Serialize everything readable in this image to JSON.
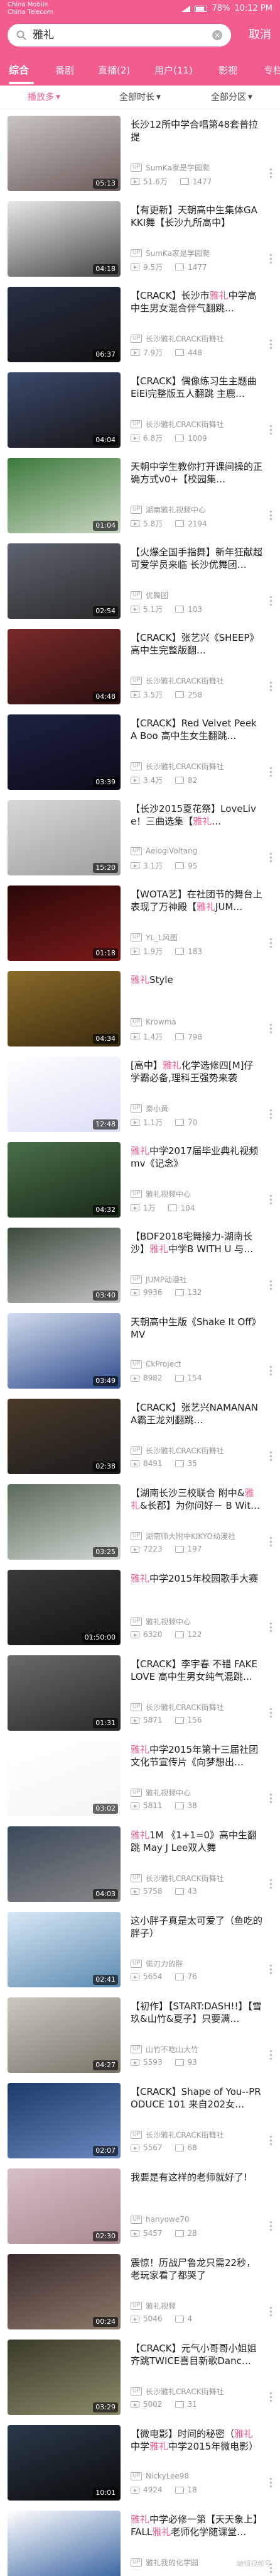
{
  "status_bar": {
    "carrier_1": "China Mobile",
    "carrier_2": "China Telecom",
    "battery": "78%",
    "time": "10:12 PM"
  },
  "search": {
    "value": "雅礼",
    "cancel_label": "取消"
  },
  "tabs": [
    "综合",
    "番剧",
    "直播(2)",
    "用户(11)",
    "影视",
    "专栏"
  ],
  "filters": {
    "sort": "播放多",
    "duration": "全部时长",
    "zone": "全部分区"
  },
  "highlight_keyword": "雅礼",
  "results": [
    {
      "title": "长沙12所中学合唱第48套普拉提",
      "uploader": "SumKa家是学园爬",
      "plays": "51.6万",
      "danmaku": "1477",
      "duration": "05:13",
      "thumb_colors": [
        "#c9c4c2",
        "#6b5b58"
      ]
    },
    {
      "title": "【有更新】天朝高中生集体GAKKI舞【长沙九所高中】",
      "uploader": "SumKa家是学园爬",
      "plays": "9.5万",
      "danmaku": "1477",
      "duration": "04:18",
      "thumb_colors": [
        "#e8e8e8",
        "#444444"
      ]
    },
    {
      "title": "【CRACK】长沙市雅礼中学高中生男女混合伴气翻跳…",
      "uploader": "长沙雅礼CRACK街舞社",
      "plays": "7.9万",
      "danmaku": "448",
      "duration": "06:37",
      "thumb_colors": [
        "#263043",
        "#111111"
      ]
    },
    {
      "title": "【CRACK】偶像练习生主题曲EiEi完整版五人翻跳 主鹿…",
      "uploader": "长沙雅礼CRACK街舞社",
      "plays": "6.8万",
      "danmaku": "1009",
      "duration": "04:04",
      "thumb_colors": [
        "#3b4a6b",
        "#151515"
      ]
    },
    {
      "title": "天朝中学生教你打开课间操的正确方式v0+【校园集…",
      "uploader": "湖南雅礼视频中心",
      "plays": "5.8万",
      "danmaku": "2194",
      "duration": "01:04",
      "thumb_colors": [
        "#3c7a3a",
        "#c9d6c2"
      ]
    },
    {
      "title": "【火爆全国手指舞】新年狂献超可爱学员来临 长沙优舞团…",
      "uploader": "优舞团",
      "plays": "5.1万",
      "danmaku": "103",
      "duration": "02:54",
      "thumb_colors": [
        "#5d6470",
        "#2a2a2a"
      ]
    },
    {
      "title": "【CRACK】张艺兴《SHEEP》高中生完整版翻…",
      "uploader": "长沙雅礼CRACK街舞社",
      "plays": "3.5万",
      "danmaku": "258",
      "duration": "04:48",
      "thumb_colors": [
        "#7a2a2a",
        "#2a0f0f"
      ]
    },
    {
      "title": "【CRACK】Red Velvet Peek A Boo 高中生女生翻跳…",
      "uploader": "长沙雅礼CRACK街舞社",
      "plays": "3.4万",
      "danmaku": "82",
      "duration": "03:39",
      "thumb_colors": [
        "#1c2240",
        "#0b0b18"
      ]
    },
    {
      "title": "【长沙2015夏花祭】LoveLive！三曲选集【雅礼…",
      "uploader": "AeiogiVoltang",
      "plays": "3.1万",
      "danmaku": "95",
      "duration": "15:20",
      "thumb_colors": [
        "#d8d8d8",
        "#9e9e9e"
      ]
    },
    {
      "title": "【WOTA艺】在社团节的舞台上表现了万神殿【雅礼JUM…",
      "uploader": "YL_L风图",
      "plays": "1.9万",
      "danmaku": "183",
      "duration": "01:18",
      "thumb_colors": [
        "#2a0808",
        "#7a1a1a"
      ]
    },
    {
      "title": "雅礼Style",
      "uploader": "Krowma",
      "plays": "1.4万",
      "danmaku": "798",
      "duration": "04:34",
      "thumb_colors": [
        "#8a6a28",
        "#3a2c10"
      ]
    },
    {
      "title": "[高中】雅礼化学选修四[M]仔学霸必备,理科王强势来袭",
      "uploader": "秦小黄",
      "plays": "1.1万",
      "danmaku": "70",
      "duration": "12:48",
      "thumb_colors": [
        "#ffffff",
        "#dadff5"
      ]
    },
    {
      "title": "雅礼中学2017届毕业典礼视频mv《记念》",
      "uploader": "雅礼视频中心",
      "plays": "1万",
      "danmaku": "104",
      "duration": "04:32",
      "thumb_colors": [
        "#4a6f4a",
        "#1a2a1a"
      ]
    },
    {
      "title": "【BDF2018宅舞接力-湖南长沙】雅礼中学B WITH U 与…",
      "uploader": "JUMP动漫社",
      "plays": "9936",
      "danmaku": "132",
      "duration": "03:40",
      "thumb_colors": [
        "#3a4a3a",
        "#c5c5c5"
      ]
    },
    {
      "title": "天朝高中生版《Shake It Off》MV",
      "uploader": "CkProject",
      "plays": "8982",
      "danmaku": "154",
      "duration": "03:49",
      "thumb_colors": [
        "#d2dced",
        "#2c4a8a"
      ]
    },
    {
      "title": "【CRACK】张艺兴NAMANANA霸王龙刘翻跳…",
      "uploader": "长沙雅礼CRACK街舞社",
      "plays": "8491",
      "danmaku": "35",
      "duration": "02:38",
      "thumb_colors": [
        "#4a3a2a",
        "#1a1a1a"
      ]
    },
    {
      "title": "【湖南长沙三校联合 附中&雅礼&长郡】为你问好－ B Wit…",
      "uploader": "湖南师大附中KIKYO动漫社",
      "plays": "7223",
      "danmaku": "197",
      "duration": "03:25",
      "thumb_colors": [
        "#5a6a5a",
        "#d0d8d0"
      ]
    },
    {
      "title": "雅礼中学2015年校园歌手大赛",
      "uploader": "雅礼视频中心",
      "plays": "6320",
      "danmaku": "122",
      "duration": "01:50:00",
      "thumb_colors": [
        "#3a3a3a",
        "#111111"
      ]
    },
    {
      "title": "【CRACK】李宇春 不错 FAKE LOVE 高中生男女纯气混跳…",
      "uploader": "长沙雅礼CRACK街舞社",
      "plays": "5871",
      "danmaku": "156",
      "duration": "01:31",
      "thumb_colors": [
        "#6a6a6a",
        "#2a2a2a"
      ]
    },
    {
      "title": "雅礼中学2015年第十三届社团文化节宣传片《向梦想出…",
      "uploader": "雅礼视频中心",
      "plays": "5811",
      "danmaku": "38",
      "duration": "03:02",
      "thumb_colors": [
        "#ffffff",
        "#f5f5f5"
      ]
    },
    {
      "title": "雅礼1M 《1+1=0》高中生翻跳 May J Lee双人舞",
      "uploader": "长沙雅礼CRACK街舞社",
      "plays": "5758",
      "danmaku": "43",
      "duration": "04:03",
      "thumb_colors": [
        "#3a4a5a",
        "#888888"
      ]
    },
    {
      "title": "这小胖子真是太可爱了（鱼吃的胖子）",
      "uploader": "偌刃力的胖",
      "plays": "5654",
      "danmaku": "76",
      "duration": "02:41",
      "thumb_colors": [
        "#d8e8f5",
        "#5a8ab0"
      ]
    },
    {
      "title": "【初作】【START:DASH!!】【雪玖&山竹&夏子】只要满…",
      "uploader": "山竹不吃山大竹",
      "plays": "5593",
      "danmaku": "93",
      "duration": "04:27",
      "thumb_colors": [
        "#ccc8c0",
        "#7a7468"
      ]
    },
    {
      "title": "【CRACK】Shape of You--PRODUCE 101 来自202女…",
      "uploader": "长沙雅礼CRACK街舞社",
      "plays": "5567",
      "danmaku": "68",
      "duration": "02:07",
      "thumb_colors": [
        "#1a3a6a",
        "#6a8ac0"
      ]
    },
    {
      "title": "我要是有这样的老师就好了!",
      "uploader": "hanyowe70",
      "plays": "5457",
      "danmaku": "28",
      "duration": "02:30",
      "thumb_colors": [
        "#d5bfc5",
        "#a88a90"
      ]
    },
    {
      "title": "震惊！历战尸鲁龙只需22秒，老玩家看了都哭了",
      "uploader": "雅礼视频",
      "plays": "5046",
      "danmaku": "4",
      "duration": "00:24",
      "thumb_colors": [
        "#3a2a2a",
        "#8a7a6a"
      ]
    },
    {
      "title": "【CRACK】元气小哥哥小姐姐齐跳TWICE喜目新歌Danc…",
      "uploader": "长沙雅礼CRACK街舞社",
      "plays": "5002",
      "danmaku": "31",
      "duration": "03:29",
      "thumb_colors": [
        "#3a3a2a",
        "#8a8a6a"
      ]
    },
    {
      "title": "【微电影】时间的秘密（雅礼中学雅礼中学2015年微电影）",
      "uploader": "NickyLee98",
      "plays": "4924",
      "danmaku": "18",
      "duration": "10:01",
      "thumb_colors": [
        "#2a3a4a",
        "#0a0a0a"
      ]
    },
    {
      "title": "雅礼中学必修一第【天天象上】FALL雅礼老师化学随课堂…",
      "uploader": "雅礼我的化学园",
      "plays": "",
      "danmaku": "",
      "duration": "",
      "thumb_colors": [
        "#ffffff",
        "#2a5a9a"
      ]
    }
  ],
  "watermark": "编辑视频号"
}
